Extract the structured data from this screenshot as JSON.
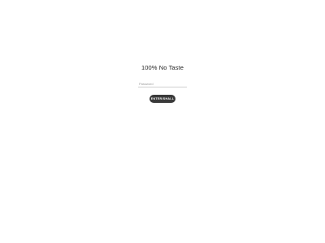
{
  "store": {
    "title": "100% No Taste"
  },
  "password_form": {
    "password_placeholder": "Password",
    "password_value": "",
    "enter_button_label": "ENTER/SHALL"
  }
}
